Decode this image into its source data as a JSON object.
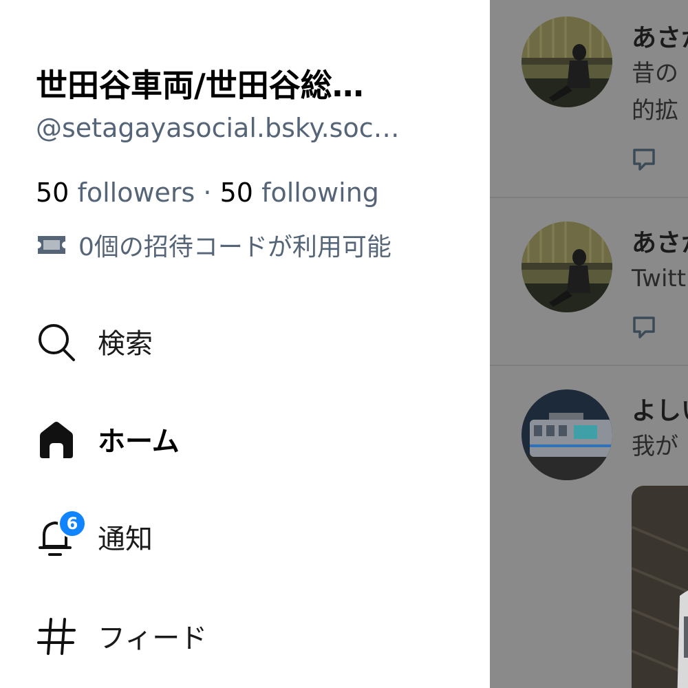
{
  "profile": {
    "display_name": "世田谷車両/世田谷総…",
    "handle": "@setagayasocial.bsky.soc…",
    "followers_count": "50",
    "followers_label": "followers",
    "separator": "·",
    "following_count": "50",
    "following_label": "following",
    "invite_codes": "0個の招待コードが利用可能"
  },
  "nav": {
    "search": {
      "label": "検索",
      "icon": "search-icon"
    },
    "home": {
      "label": "ホーム",
      "icon": "home-icon",
      "active": true
    },
    "notifications": {
      "label": "通知",
      "icon": "bell-icon",
      "badge": "6"
    },
    "feeds": {
      "label": "フィード",
      "icon": "hash-icon"
    }
  },
  "feed": {
    "posts": [
      {
        "author": "あさか",
        "lines": [
          "昔の",
          "的拡"
        ]
      },
      {
        "author": "あさか",
        "lines": [
          "Twitt"
        ]
      },
      {
        "author": "よしい",
        "lines": [
          "我が"
        ]
      }
    ]
  },
  "colors": {
    "accent": "#1083fe",
    "secondary_text": "#556577",
    "scrim": "#8a8a8a"
  }
}
